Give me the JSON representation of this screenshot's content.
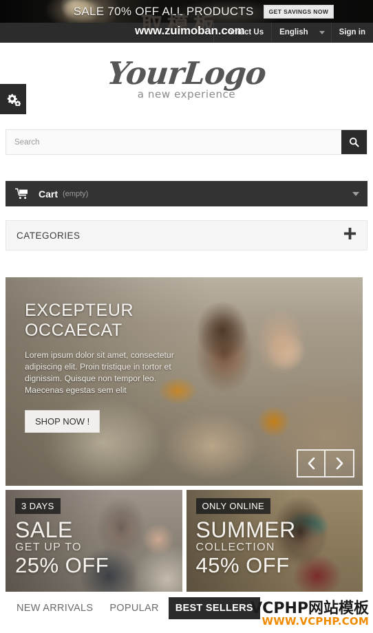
{
  "promo": {
    "text": "SALE 70% OFF ALL PRODUCTS",
    "button": "GET SAVINGS NOW"
  },
  "utility_nav": {
    "contact": "Contact Us",
    "language": "English",
    "signin": "Sign in"
  },
  "watermarks": {
    "top_url": "www.zuimoban.com",
    "top_cjk": "取模板",
    "bottom_cjk": "VCPHP网站模板",
    "bottom_url": "WWW.VCPHP.COM"
  },
  "header": {
    "logo": "YourLogo",
    "tagline": "a new experience",
    "cog_icon": "cogs-icon"
  },
  "search": {
    "placeholder": "Search",
    "value": "",
    "icon": "search-icon"
  },
  "cart": {
    "icon": "shopping-cart-icon",
    "label": "Cart",
    "status": "(empty)",
    "caret": "chevron-down-icon"
  },
  "categories": {
    "label": "CATEGORIES",
    "toggle_icon": "plus-icon"
  },
  "hero": {
    "title_line1": "EXCEPTEUR",
    "title_line2": "OCCAECAT",
    "description": "Lorem ipsum dolor sit amet, consectetur adipiscing elit. Proin tristique in tortor et dignissim. Quisque non tempor leo. Maecenas egestas sem elit",
    "cta": "SHOP NOW !",
    "prev_icon": "chevron-left-icon",
    "next_icon": "chevron-right-icon"
  },
  "tiles": [
    {
      "chip": "3 DAYS",
      "big": "SALE",
      "sub": "GET UP TO",
      "off": "25% OFF"
    },
    {
      "chip": "ONLY ONLINE",
      "big": "SUMMER",
      "sub": "COLLECTION",
      "off": "45% OFF"
    }
  ],
  "tabs": [
    {
      "label": "NEW ARRIVALS",
      "active": false
    },
    {
      "label": "POPULAR",
      "active": false
    },
    {
      "label": "BEST SELLERS",
      "active": true
    }
  ],
  "colors": {
    "dark": "#2b2b2b",
    "promo_bg": "#0c0b0a",
    "util_bg": "#2c2c2c",
    "accent_orange": "#f08a00",
    "panel": "#f6f6f6"
  }
}
